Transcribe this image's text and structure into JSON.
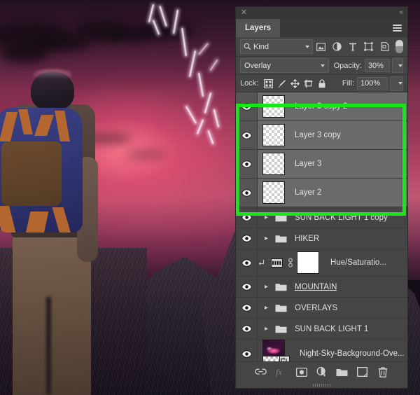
{
  "app": {
    "panel_title": "Layers",
    "close_icon": "close-x-icon",
    "collapse_icon": "collapse-double-chevron-icon",
    "menu_icon": "panel-menu-hamburger-icon"
  },
  "filter_row": {
    "kind_label": "Kind",
    "search_icon": "magnifier-icon",
    "icons": [
      {
        "name": "filter-pixel-layers-icon",
        "glyph": "image"
      },
      {
        "name": "filter-adjustment-layers-icon",
        "glyph": "half-circle"
      },
      {
        "name": "filter-type-layers-icon",
        "glyph": "T"
      },
      {
        "name": "filter-shape-layers-icon",
        "glyph": "shape"
      },
      {
        "name": "filter-smart-object-layers-icon",
        "glyph": "smart-object"
      }
    ],
    "toggle_name": "filter-enable-toggle"
  },
  "blend_row": {
    "blend_mode": "Overlay",
    "opacity_label": "Opacity:",
    "opacity_value": "30%"
  },
  "lock_row": {
    "lock_label": "Lock:",
    "lock_icons": [
      {
        "name": "lock-transparent-pixels-icon"
      },
      {
        "name": "lock-image-pixels-brush-icon"
      },
      {
        "name": "lock-position-move-icon"
      },
      {
        "name": "lock-artboard-nesting-icon"
      },
      {
        "name": "lock-all-padlock-icon"
      }
    ],
    "fill_label": "Fill:",
    "fill_value": "100%"
  },
  "layers": [
    {
      "name": "Layer 3 copy 2",
      "type": "pixel",
      "visible": true,
      "selected": true,
      "thumb": "transparent-checker",
      "underlined": false
    },
    {
      "name": "Layer 3 copy",
      "type": "pixel",
      "visible": true,
      "selected": true,
      "thumb": "transparent-checker",
      "underlined": false
    },
    {
      "name": "Layer 3",
      "type": "pixel",
      "visible": true,
      "selected": true,
      "thumb": "transparent-checker",
      "underlined": false
    },
    {
      "name": "Layer 2",
      "type": "pixel",
      "visible": true,
      "selected": true,
      "thumb": "transparent-checker",
      "underlined": false
    },
    {
      "name": "SUN BACK LIGHT 1 copy",
      "type": "group",
      "visible": true,
      "selected": false,
      "underlined": false
    },
    {
      "name": "HIKER",
      "type": "group",
      "visible": true,
      "selected": false,
      "underlined": false
    },
    {
      "name": "Hue/Saturatio...",
      "type": "adjustment",
      "visible": true,
      "selected": false,
      "clipped": true,
      "mask": "white-mask",
      "underlined": false
    },
    {
      "name": "MOUNTAIN",
      "type": "group",
      "visible": true,
      "selected": false,
      "underlined": true
    },
    {
      "name": "OVERLAYS",
      "type": "group",
      "visible": true,
      "selected": false,
      "underlined": false
    },
    {
      "name": "SUN BACK LIGHT 1",
      "type": "group",
      "visible": true,
      "selected": false,
      "underlined": false
    },
    {
      "name": "Night-Sky-Background-Ove...",
      "type": "smart-object",
      "visible": true,
      "selected": false,
      "thumb": "night-sky-nebula",
      "underlined": false
    }
  ],
  "bottom_bar": {
    "icons": [
      {
        "name": "link-layers-icon",
        "glyph": "link",
        "disabled": false
      },
      {
        "name": "layer-style-fx-icon",
        "glyph": "fx",
        "disabled": true
      },
      {
        "name": "add-layer-mask-icon",
        "glyph": "mask",
        "disabled": false
      },
      {
        "name": "new-adjustment-layer-icon",
        "glyph": "adjustment",
        "disabled": false
      },
      {
        "name": "new-group-icon",
        "glyph": "folder",
        "disabled": false
      },
      {
        "name": "new-layer-icon",
        "glyph": "new-layer",
        "disabled": false
      },
      {
        "name": "delete-layer-icon",
        "glyph": "trash",
        "disabled": false
      }
    ]
  },
  "highlight": {
    "color": "#19e619",
    "description": "green-selection-highlight"
  },
  "artwork": {
    "description": "hiker-with-backpack-facing-mountain-under-pink-stormy-sky-with-lightning"
  },
  "colors": {
    "panel_bg": "#454545",
    "panel_tab_active": "#535353",
    "row_selected": "#6a6a6a",
    "text": "#e2e2e2",
    "accent_green": "#19e619"
  }
}
